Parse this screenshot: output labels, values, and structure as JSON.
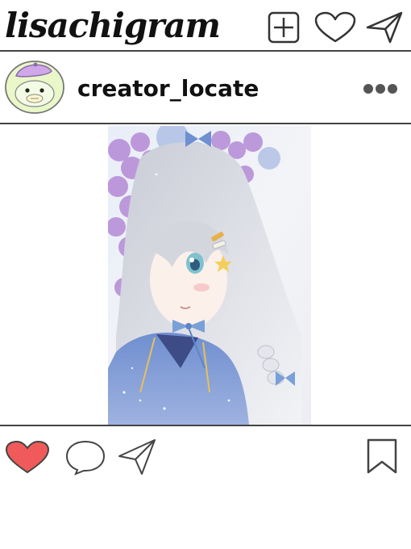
{
  "header": {
    "logo": "lisachigram",
    "icons": [
      "add-post-icon",
      "heart-icon",
      "send-icon"
    ]
  },
  "post": {
    "username": "creator_locate",
    "avatar_icon": "duck-avatar-icon",
    "more_icon": "more-options-icon",
    "image_alt": "watercolor illustration of girl with wisteria"
  },
  "actions": {
    "like_icon": "heart-filled-icon",
    "comment_icon": "comment-icon",
    "share_icon": "send-icon",
    "save_icon": "bookmark-icon",
    "liked": true
  },
  "colors": {
    "like_red": "#f05a5a",
    "border": "#444444",
    "avatar_bg": "#eaf7c9",
    "avatar_hat": "#c9a7e8"
  }
}
